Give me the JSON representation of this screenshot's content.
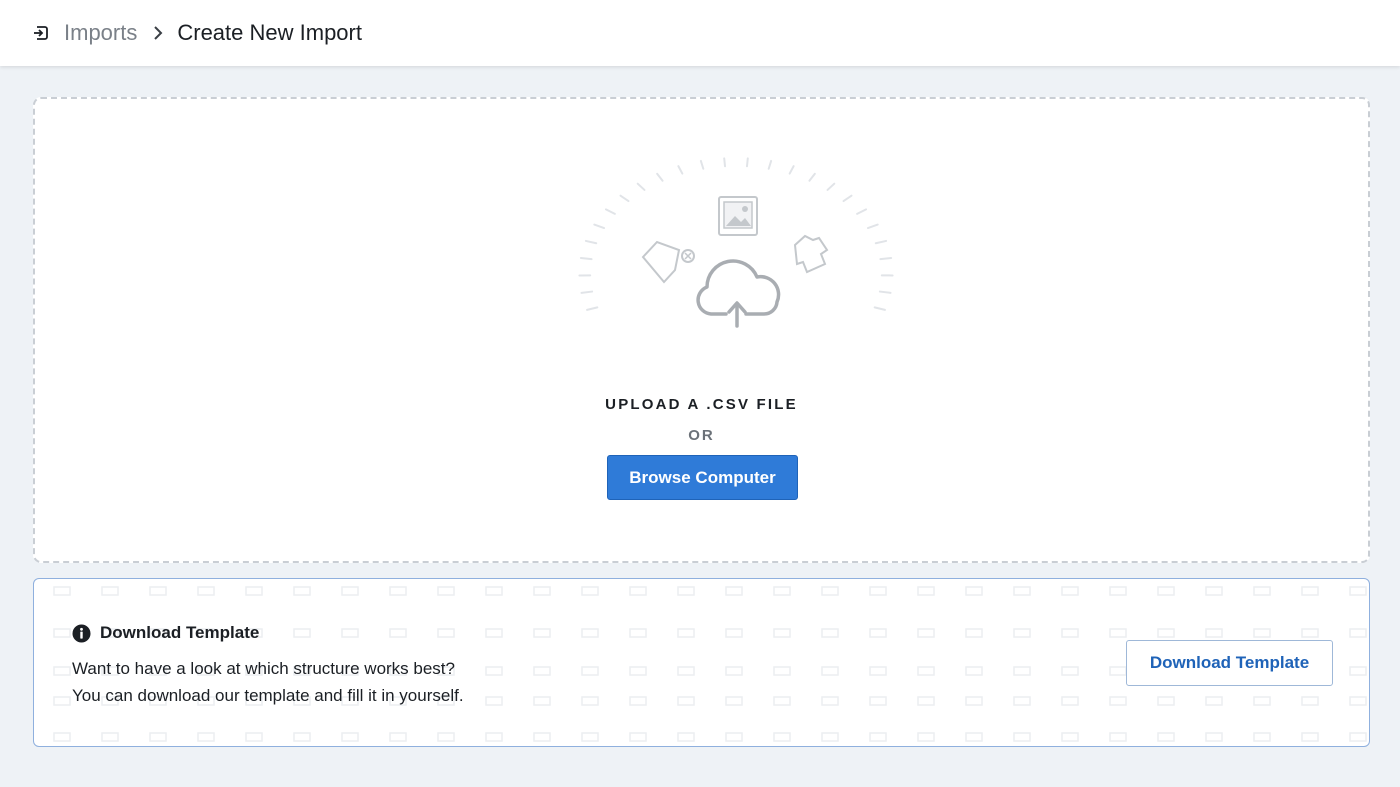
{
  "breadcrumb": {
    "icon": "import-icon",
    "root": "Imports",
    "separator_icon": "chevron-right-icon",
    "current": "Create New Import"
  },
  "upload": {
    "title": "UPLOAD A .CSV FILE",
    "or": "OR",
    "browse_label": "Browse Computer"
  },
  "template": {
    "icon": "info-icon",
    "title": "Download Template",
    "line1": "Want to have a look at which structure works best?",
    "line2": "You can download our template and fill it in yourself.",
    "button_label": "Download Template"
  },
  "colors": {
    "page_background": "#eef2f6",
    "primary_button": "#2f7bd8",
    "link_blue": "#1f63b8",
    "panel_border": "#8fb0de"
  }
}
